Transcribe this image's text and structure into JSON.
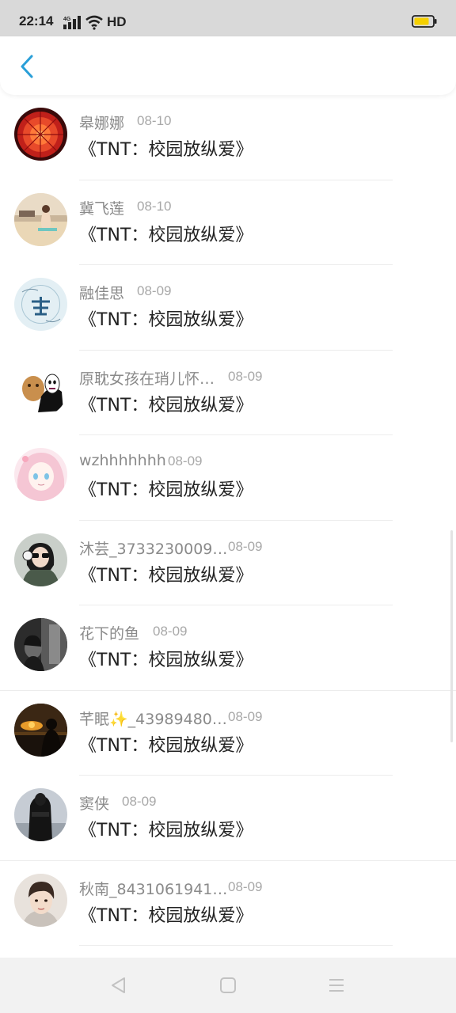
{
  "status_bar": {
    "time": "22:14",
    "network": "4G",
    "hd": "HD",
    "battery_color": "#f5d000"
  },
  "header": {
    "back_icon": "chevron-left-icon",
    "accent_color": "#2a9fd8"
  },
  "list": [
    {
      "username": "皋娜娜",
      "date": "08-10",
      "title": "《TNT：校园放纵爱》",
      "avatar": "red-flower"
    },
    {
      "username": "冀飞莲",
      "date": "08-10",
      "title": "《TNT：校园放纵爱》",
      "avatar": "beach-girl"
    },
    {
      "username": "融佳思",
      "date": "08-09",
      "title": "《TNT：校园放纵爱》",
      "avatar": "text-circle"
    },
    {
      "username": "原耽女孩在琑儿怀…",
      "date": "08-09",
      "title": "《TNT：校园放纵爱》",
      "avatar": "cartoon-faceless"
    },
    {
      "username": "wzhhhhhhh",
      "date": "08-09",
      "title": "《TNT：校园放纵爱》",
      "avatar": "anime-girl"
    },
    {
      "username": "沐芸_3733230009…",
      "date": "08-09",
      "title": "《TNT：校园放纵爱》",
      "avatar": "girl-sunglasses"
    },
    {
      "username": "花下的鱼",
      "date": "08-09",
      "title": "《TNT：校园放纵爱》",
      "avatar": "dark-photo"
    },
    {
      "username": "芊眠✨_43989480…",
      "date": "08-09",
      "title": "《TNT：校园放纵爱》",
      "avatar": "sunset"
    },
    {
      "username": "窦侠",
      "date": "08-09",
      "title": "《TNT：校园放纵爱》",
      "avatar": "dark-figure"
    },
    {
      "username": "秋南_8431061941…",
      "date": "08-09",
      "title": "《TNT：校园放纵爱》",
      "avatar": "boy-portrait"
    }
  ],
  "nav": {
    "back": "triangle-back-icon",
    "home": "square-home-icon",
    "menu": "menu-lines-icon"
  }
}
